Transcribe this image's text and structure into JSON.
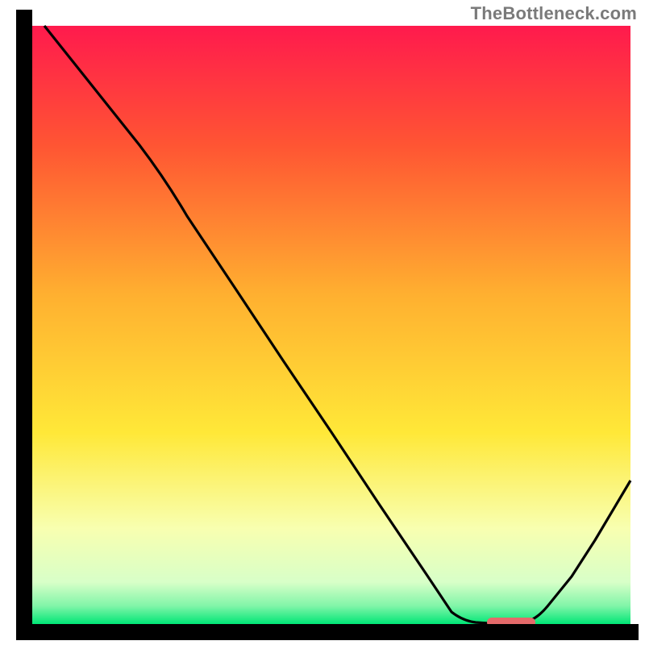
{
  "watermark": {
    "text": "TheBottleneck.com"
  },
  "chart_data": {
    "type": "line",
    "title": "",
    "xlabel": "",
    "ylabel": "",
    "xlim": [
      0,
      100
    ],
    "ylim": [
      0,
      100
    ],
    "series": [
      {
        "name": "curve",
        "x": [
          2,
          10,
          18,
          26,
          34,
          42,
          50,
          58,
          66,
          70,
          74,
          78,
          82,
          86,
          90,
          94,
          100
        ],
        "y": [
          100,
          90,
          80,
          72,
          60,
          48,
          36,
          24,
          12,
          6,
          2,
          0,
          0,
          3,
          8,
          14,
          24
        ]
      }
    ],
    "marker": {
      "name": "optimal-range",
      "x_start": 76,
      "x_end": 84,
      "y": 0,
      "color": "#e46a6a"
    },
    "background_gradient": {
      "top": "#ff1a4d",
      "mid_high": "#ff9933",
      "mid": "#ffe838",
      "mid_low": "#f8ffb0",
      "low": "#00e676"
    },
    "axes_color": "#000000"
  }
}
